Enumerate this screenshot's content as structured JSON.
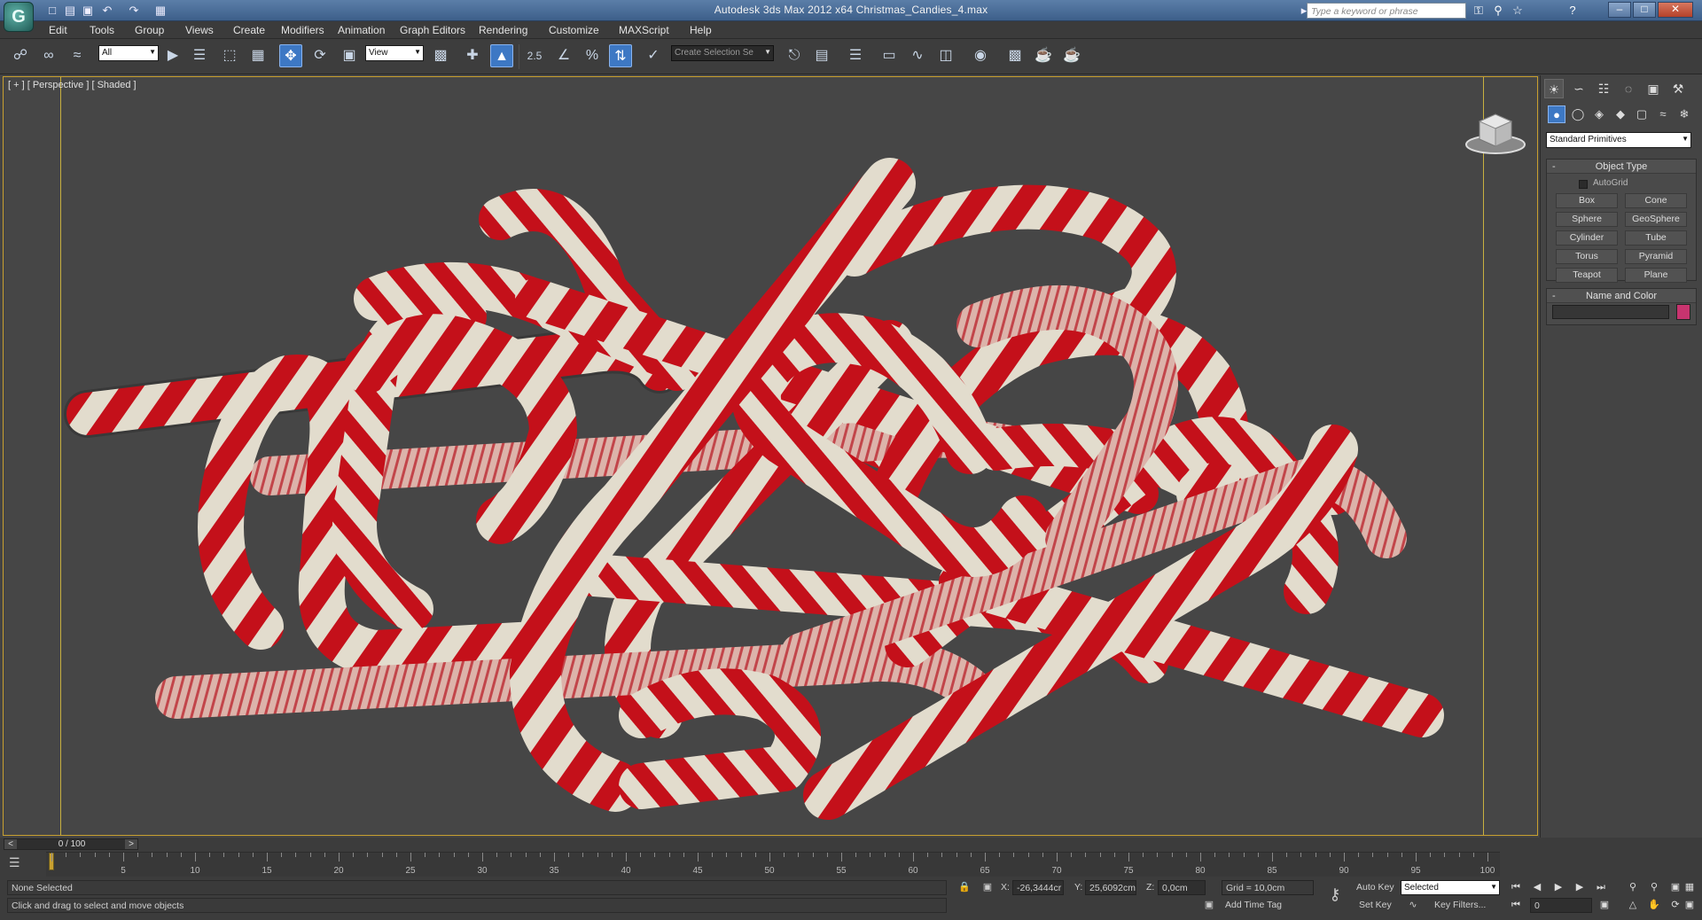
{
  "app": {
    "title": "Autodesk 3ds Max  2012 x64     Christmas_Candies_4.max",
    "logo_letter": "G"
  },
  "search": {
    "placeholder": "Type a keyword or phrase"
  },
  "menu": [
    "Edit",
    "Tools",
    "Group",
    "Views",
    "Create",
    "Modifiers",
    "Animation",
    "Graph Editors",
    "Rendering",
    "Customize",
    "MAXScript",
    "Help"
  ],
  "toolbar": {
    "selection_filter": "All",
    "ref_coord": "View",
    "snaps_label": "2.5",
    "percent_label": "%",
    "named_selection": "Create Selection Se"
  },
  "viewport": {
    "label": "[ + ] [ Perspective ] [ Shaded ]"
  },
  "command_panel": {
    "category": "Standard Primitives",
    "object_type": {
      "header": "Object Type",
      "autogrid": "AutoGrid",
      "buttons": [
        "Box",
        "Cone",
        "Sphere",
        "GeoSphere",
        "Cylinder",
        "Tube",
        "Torus",
        "Pyramid",
        "Teapot",
        "Plane"
      ]
    },
    "name_color": {
      "header": "Name and Color",
      "color": "#c8346f"
    }
  },
  "timeline": {
    "frame": "0 / 100",
    "ticks": [
      "5",
      "10",
      "15",
      "20",
      "25",
      "30",
      "35",
      "40",
      "45",
      "50",
      "55",
      "60",
      "65",
      "70",
      "75",
      "80",
      "85",
      "90",
      "95",
      "100"
    ]
  },
  "status": {
    "selection": "None Selected",
    "prompt": "Click and drag to select and move objects",
    "x_label": "X:",
    "x_value": "-26,3444cr",
    "y_label": "Y:",
    "y_value": "25,6092cm",
    "z_label": "Z:",
    "z_value": "0,0cm",
    "grid": "Grid = 10,0cm",
    "add_time_tag": "Add Time Tag",
    "auto_key": "Auto Key",
    "set_key": "Set Key",
    "key_mode": "Selected",
    "key_filters": "Key Filters...",
    "current_frame": "0"
  },
  "colors": {
    "candy_red": "#c4101a",
    "candy_white": "#e2dccd",
    "viewport_bg": "#464646",
    "highlight_blue": "#3d78c4"
  }
}
